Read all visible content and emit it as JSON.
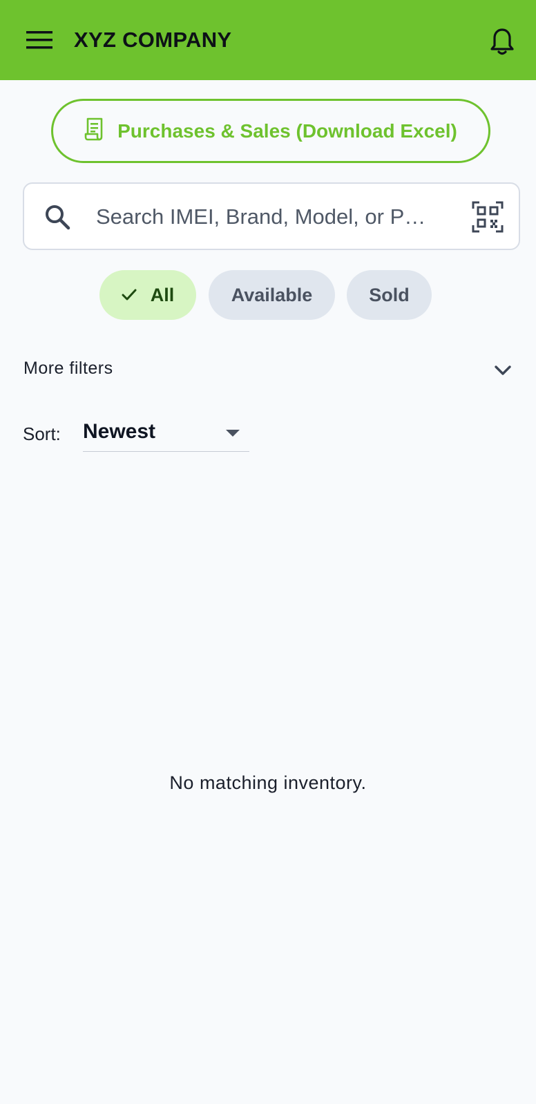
{
  "app_bar": {
    "title": "XYZ COMPANY",
    "menu_icon": "hamburger-menu-icon",
    "notification_icon": "bell-icon",
    "color": "#6ec22e"
  },
  "actions": {
    "download_label": "Purchases & Sales (Download Excel)",
    "download_icon": "receipt-icon"
  },
  "search": {
    "value": "",
    "placeholder": "Search IMEI, Brand, Model, or P…",
    "search_icon": "search-icon",
    "scan_icon": "qr-code-scan-icon"
  },
  "filter_chips": [
    {
      "label": "All",
      "selected": true
    },
    {
      "label": "Available",
      "selected": false
    },
    {
      "label": "Sold",
      "selected": false
    }
  ],
  "more_filters": {
    "label": "More filters",
    "icon": "chevron-down-icon"
  },
  "sort": {
    "label": "Sort:",
    "value": "Newest"
  },
  "empty_state": {
    "message": "No matching inventory."
  }
}
